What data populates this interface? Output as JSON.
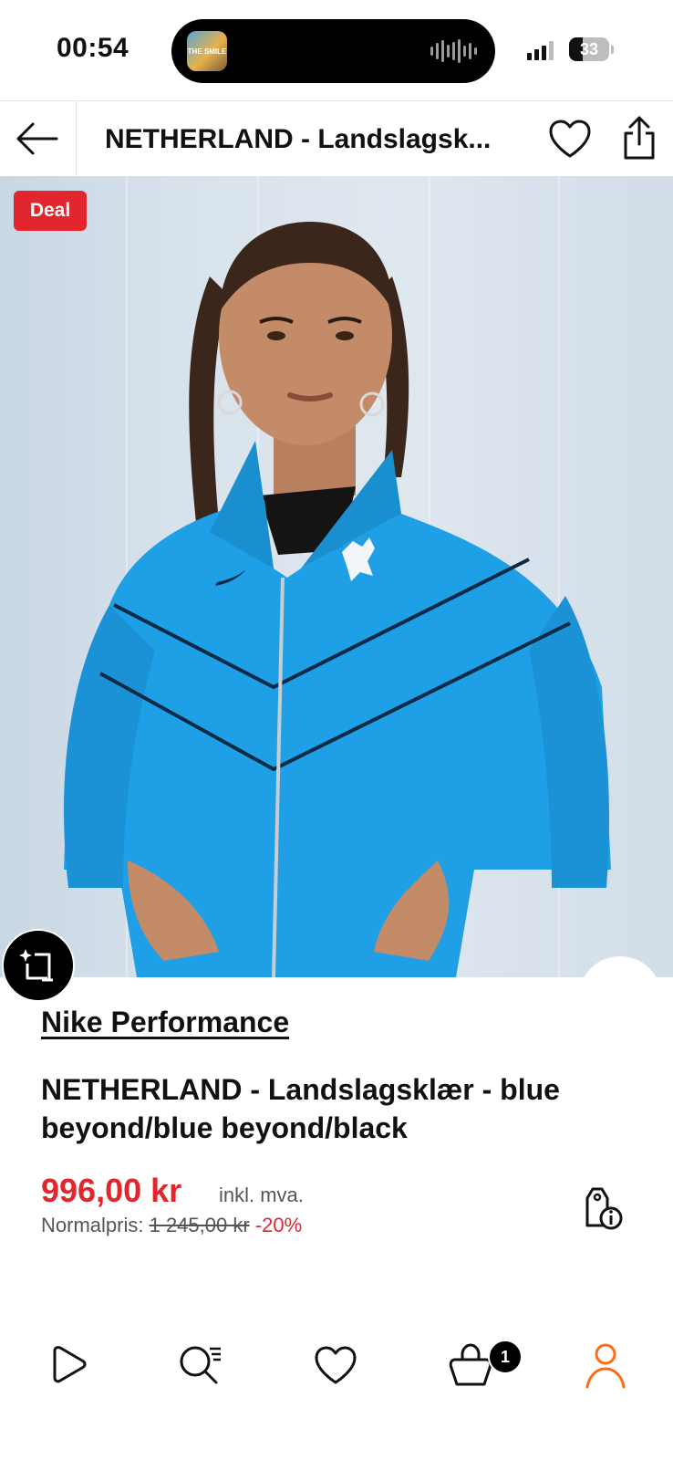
{
  "status_bar": {
    "time": "00:54",
    "now_playing_art_text": "THE SMILE",
    "battery": "33",
    "battery_level_pct": 33
  },
  "header": {
    "title": "NETHERLAND  - Landslagsk...",
    "back_icon": "arrow-left-icon",
    "favorite_icon": "heart-outline-icon",
    "share_icon": "share-icon"
  },
  "hero": {
    "badge": "Deal",
    "ai_button_icon": "sparkle-crop-icon"
  },
  "product": {
    "brand": "Nike Performance",
    "name": "NETHERLAND  - Landslagsklær - blue beyond/blue beyond/black",
    "price": "996,00 kr",
    "vat_note": "inkl. mva.",
    "normal_label": "Normalpris:",
    "normal_price": "1 245,00 kr",
    "discount": "-20%",
    "price_info_icon": "price-tag-info-icon"
  },
  "tab_bar": {
    "items": [
      {
        "name": "home",
        "icon": "play-icon"
      },
      {
        "name": "search",
        "icon": "search-list-icon"
      },
      {
        "name": "wishlist",
        "icon": "heart-icon"
      },
      {
        "name": "cart",
        "icon": "bag-icon"
      },
      {
        "name": "profile",
        "icon": "person-icon"
      }
    ],
    "cart_count": "1"
  },
  "colors": {
    "accent_red": "#e1262d",
    "profile_orange": "#ff6a13",
    "jacket_blue": "#1e9fe6"
  }
}
